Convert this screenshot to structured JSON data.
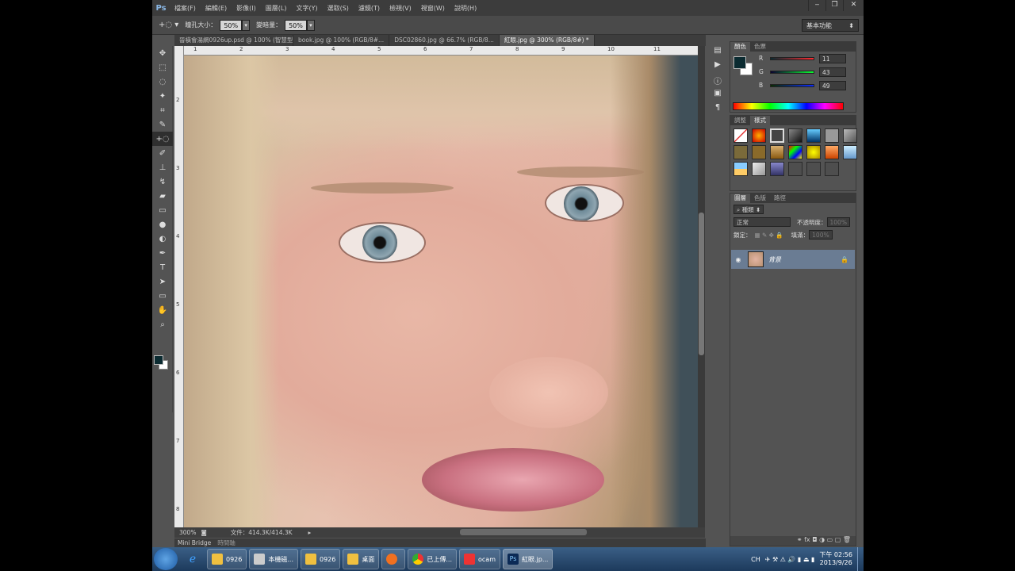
{
  "menubar": {
    "logo": "Ps",
    "menus": [
      "檔案(F)",
      "編輯(E)",
      "影像(I)",
      "圖層(L)",
      "文字(Y)",
      "選取(S)",
      "濾鏡(T)",
      "檢視(V)",
      "視窗(W)",
      "說明(H)"
    ],
    "window_controls": [
      "‒",
      "❐",
      "✕"
    ]
  },
  "options": {
    "tool_icon": "redeye-tool-icon",
    "pupil_label": "瞳孔大小：",
    "pupil_value": "50%",
    "darken_label": "變暗量：",
    "darken_value": "50%",
    "workspace": "基本功能"
  },
  "tabs": [
    {
      "label": "晉橫會湯網0926up.psd @ 100% (智慧型圖層, CMYK/8...",
      "active": false
    },
    {
      "label": "book.jpg @ 100% (RGB/8#...",
      "active": false
    },
    {
      "label": "DSC02860.jpg @ 66.7% (RGB/8...",
      "active": false
    },
    {
      "label": "紅眼.jpg @ 300% (RGB/8#) *",
      "active": true
    }
  ],
  "ruler": {
    "top_ticks": [
      "1",
      "2",
      "3",
      "4",
      "5",
      "6",
      "7",
      "8",
      "9",
      "10",
      "11"
    ],
    "left_ticks": [
      "2",
      "3",
      "4",
      "5",
      "6",
      "7",
      "8"
    ]
  },
  "status": {
    "zoom": "300%",
    "doc_info": "文件：414.3K/414.3K"
  },
  "bottom_panel": {
    "tabs": [
      "Mini Bridge",
      "時間軸"
    ]
  },
  "color_panel": {
    "tabs": [
      "顏色",
      "色票"
    ],
    "fg": "#0b2b31",
    "bg": "#ffffff",
    "channels": [
      {
        "label": "R",
        "value": "11"
      },
      {
        "label": "G",
        "value": "43"
      },
      {
        "label": "B",
        "value": "49"
      }
    ]
  },
  "styles_panel": {
    "tabs": [
      "調整",
      "樣式"
    ]
  },
  "layers_panel": {
    "tabs": [
      "圖層",
      "色版",
      "路徑"
    ],
    "filter": "種類",
    "blend_mode": "正常",
    "opacity_label": "不透明度：",
    "opacity_value": "100%",
    "lock_label": "鎖定：",
    "fill_label": "填滿：",
    "fill_value": "100%",
    "layers": [
      {
        "name": "背景",
        "locked": true
      }
    ]
  },
  "taskbar": {
    "items": [
      {
        "label": "0926",
        "icon": "folder-icon"
      },
      {
        "label": "本機磁...",
        "icon": "drive-icon"
      },
      {
        "label": "0926",
        "icon": "folder-icon"
      },
      {
        "label": "桌面",
        "icon": "folder-icon"
      },
      {
        "label": "",
        "icon": "media-player-icon"
      },
      {
        "label": "已上傳...",
        "icon": "chrome-icon"
      },
      {
        "label": "ocam",
        "icon": "ocam-icon"
      },
      {
        "label": "紅眼.jp...",
        "icon": "photoshop-icon"
      }
    ],
    "ime": "CH",
    "clock_time": "下午 02:56",
    "clock_date": "2013/9/26"
  }
}
